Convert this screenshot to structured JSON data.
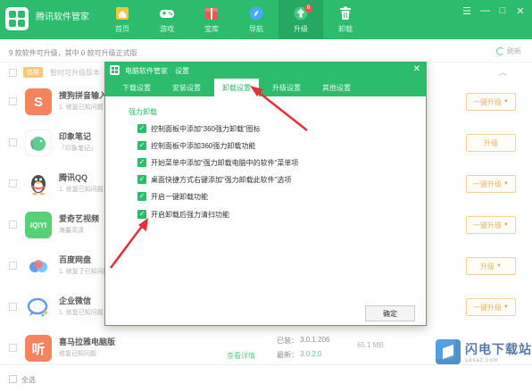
{
  "header": {
    "title": "腾讯软件管家",
    "nav": [
      {
        "label": "首页",
        "icon": "home-icon",
        "color": "#f5c542"
      },
      {
        "label": "游戏",
        "icon": "gamepad-icon",
        "color": "#ffffff"
      },
      {
        "label": "宝库",
        "icon": "gift-icon",
        "color": "#e85a4f"
      },
      {
        "label": "导航",
        "icon": "compass-icon",
        "color": "#4aa8ff"
      },
      {
        "label": "升级",
        "icon": "upgrade-icon",
        "color": "#ffffff",
        "badge": "8"
      },
      {
        "label": "卸载",
        "icon": "trash-icon",
        "color": "#ffffff"
      }
    ],
    "window_controls": [
      "☰",
      "—",
      "□",
      "✕"
    ]
  },
  "status": {
    "text": "9 款软件可升级，其中 0 款可升级正式版",
    "refresh_label": "刷新"
  },
  "list_header": {
    "tag": "忽略",
    "note": "暂时可升级版本"
  },
  "software": [
    {
      "name": "搜狗拼音输入",
      "desc": "1. 修复已知问题",
      "btn": "一键升级",
      "icon_text": "S",
      "icon_color": "#f25a2a"
    },
    {
      "name": "印象笔记",
      "desc": "「印象笔记」",
      "btn": "升级",
      "icon_text": "🐘",
      "icon_color": "#2dbb6d"
    },
    {
      "name": "腾讯QQ",
      "desc": "1. 修复已知问题",
      "btn": "一键升级",
      "icon_text": "🐧",
      "icon_color": "#ffffff"
    },
    {
      "name": "爱奇艺视频",
      "desc": "海量高清",
      "btn": "一键升级",
      "icon_text": "iQIYI",
      "icon_color": "#1fc04e"
    },
    {
      "name": "百度网盘",
      "desc": "1. 修复了已知问题",
      "btn": "升级",
      "icon_text": "☁",
      "icon_color": "#ffffff"
    },
    {
      "name": "企业微信",
      "desc": "1. 修复已知问题",
      "btn": "一键升级",
      "icon_text": "💬",
      "icon_color": "#ffffff"
    },
    {
      "name": "喜马拉雅电脑版",
      "desc": "修复已知问题",
      "btn": "一键升级",
      "icon_text": "听",
      "icon_color": "#f25a2a"
    }
  ],
  "last_row_extra": {
    "label1": "已装：",
    "value1": "3.0.1.206",
    "label2": "最新：",
    "value2": "3.0.2.0",
    "size": "65.1 MB",
    "link": "查看详情"
  },
  "bottom": {
    "select_all": "全选"
  },
  "watermark": {
    "text": "闪电下载站",
    "sub": "sdxaz.com"
  },
  "dialog": {
    "title": "电脑软件管家　设置",
    "close": "✕",
    "tabs": [
      "下载设置",
      "安装设置",
      "卸载设置",
      "升级设置",
      "其他设置"
    ],
    "active_tab": 2,
    "section": "强力卸载",
    "options": [
      "控制面板中添加“360强力卸载”图标",
      "控制面板中添加360强力卸载功能",
      "开始菜单中添加“强力卸载电脑中的软件”菜单项",
      "桌面快捷方式右键添加“强力卸载此软件”选项",
      "开启一键卸载功能",
      "开启卸载后强力清扫功能"
    ],
    "ok_label": "确定"
  }
}
